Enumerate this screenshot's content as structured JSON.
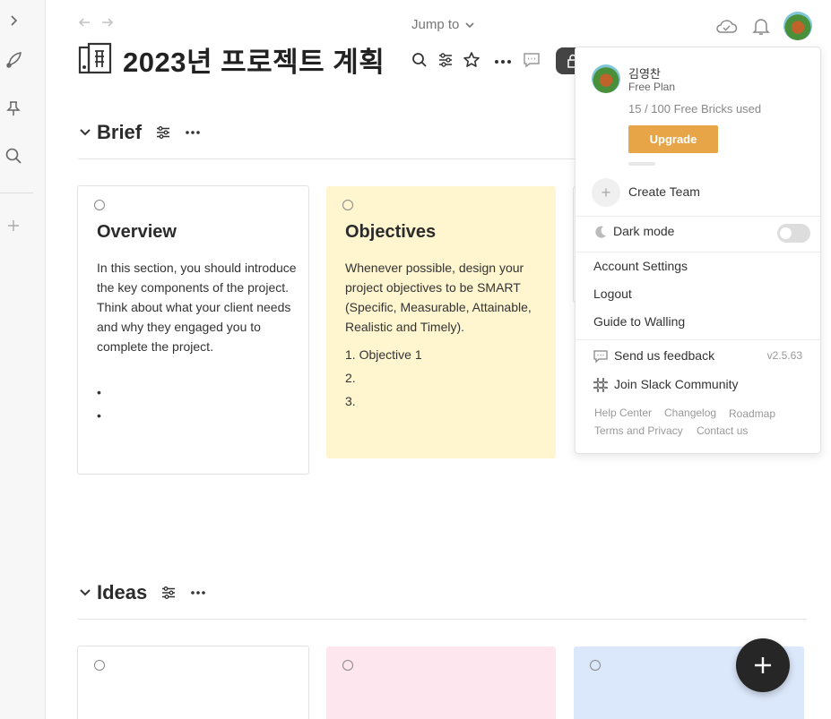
{
  "topbar": {
    "jump_label": "Jump to"
  },
  "page": {
    "title": "2023년 프로젝트 계획"
  },
  "sections": {
    "brief": {
      "title": "Brief",
      "cards": {
        "overview": {
          "title": "Overview",
          "body": "In this section, you should introduce the key components of the project. Think about what your client needs and why they engaged you to complete the project.",
          "bullets": [
            "•",
            "•"
          ]
        },
        "objectives": {
          "title": "Objectives",
          "body": "Whenever possible, design your project objectives to be SMART (Specific, Measurable, Attainable, Realistic and Timely).",
          "items": [
            "1.  Objective 1",
            "2.",
            "3."
          ]
        }
      }
    },
    "ideas": {
      "title": "Ideas"
    }
  },
  "menu": {
    "user_name": "김영찬",
    "plan": "Free Plan",
    "bricks_used": "15 / 100 Free Bricks used",
    "upgrade_label": "Upgrade",
    "create_team_label": "Create Team",
    "dark_mode_label": "Dark mode",
    "dark_mode_on": false,
    "account_settings": "Account Settings",
    "logout": "Logout",
    "guide": "Guide to Walling",
    "feedback": "Send us feedback",
    "version": "v2.5.63",
    "slack": "Join Slack Community",
    "footer_links": {
      "help_center": "Help Center",
      "changelog": "Changelog",
      "roadmap": "Roadmap",
      "terms": "Terms and Privacy",
      "contact": "Contact us"
    }
  },
  "colors": {
    "upgrade": "#e8a547",
    "card_yellow": "#fff5cf",
    "card_pink": "#fde6ee",
    "card_blue": "#dbe8fb",
    "fab": "#262626"
  }
}
